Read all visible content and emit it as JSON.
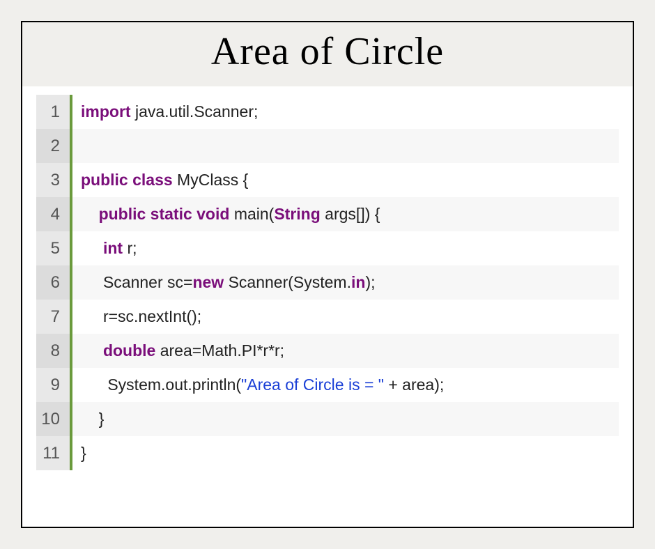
{
  "title": "Area of Circle",
  "code": {
    "lines": [
      {
        "num": "1",
        "indent": "",
        "tokens": [
          {
            "cls": "kw",
            "t": "import"
          },
          {
            "cls": "",
            "t": " java.util.Scanner;"
          }
        ]
      },
      {
        "num": "2",
        "indent": "",
        "tokens": []
      },
      {
        "num": "3",
        "indent": "",
        "tokens": [
          {
            "cls": "kw",
            "t": "public class"
          },
          {
            "cls": "",
            "t": " MyClass {"
          }
        ]
      },
      {
        "num": "4",
        "indent": "    ",
        "tokens": [
          {
            "cls": "kw",
            "t": "public static void"
          },
          {
            "cls": "",
            "t": " main("
          },
          {
            "cls": "kw",
            "t": "String"
          },
          {
            "cls": "",
            "t": " args[]) {"
          }
        ]
      },
      {
        "num": "5",
        "indent": "     ",
        "tokens": [
          {
            "cls": "kw",
            "t": "int"
          },
          {
            "cls": "",
            "t": " r;"
          }
        ]
      },
      {
        "num": "6",
        "indent": "     ",
        "tokens": [
          {
            "cls": "",
            "t": "Scanner sc="
          },
          {
            "cls": "kw",
            "t": "new"
          },
          {
            "cls": "",
            "t": " Scanner(System."
          },
          {
            "cls": "fld",
            "t": "in"
          },
          {
            "cls": "",
            "t": ");"
          }
        ]
      },
      {
        "num": "7",
        "indent": "     ",
        "tokens": [
          {
            "cls": "",
            "t": "r=sc.nextInt();"
          }
        ]
      },
      {
        "num": "8",
        "indent": "     ",
        "tokens": [
          {
            "cls": "kw",
            "t": "double"
          },
          {
            "cls": "",
            "t": " area=Math.PI*r*r;"
          }
        ]
      },
      {
        "num": "9",
        "indent": "      ",
        "tokens": [
          {
            "cls": "",
            "t": "System.out.println("
          },
          {
            "cls": "str",
            "t": "\"Area of Circle is = \""
          },
          {
            "cls": "",
            "t": " + area);"
          }
        ]
      },
      {
        "num": "10",
        "indent": "    ",
        "tokens": [
          {
            "cls": "",
            "t": "}"
          }
        ]
      },
      {
        "num": "11",
        "indent": "",
        "tokens": [
          {
            "cls": "",
            "t": "}"
          }
        ]
      }
    ]
  }
}
